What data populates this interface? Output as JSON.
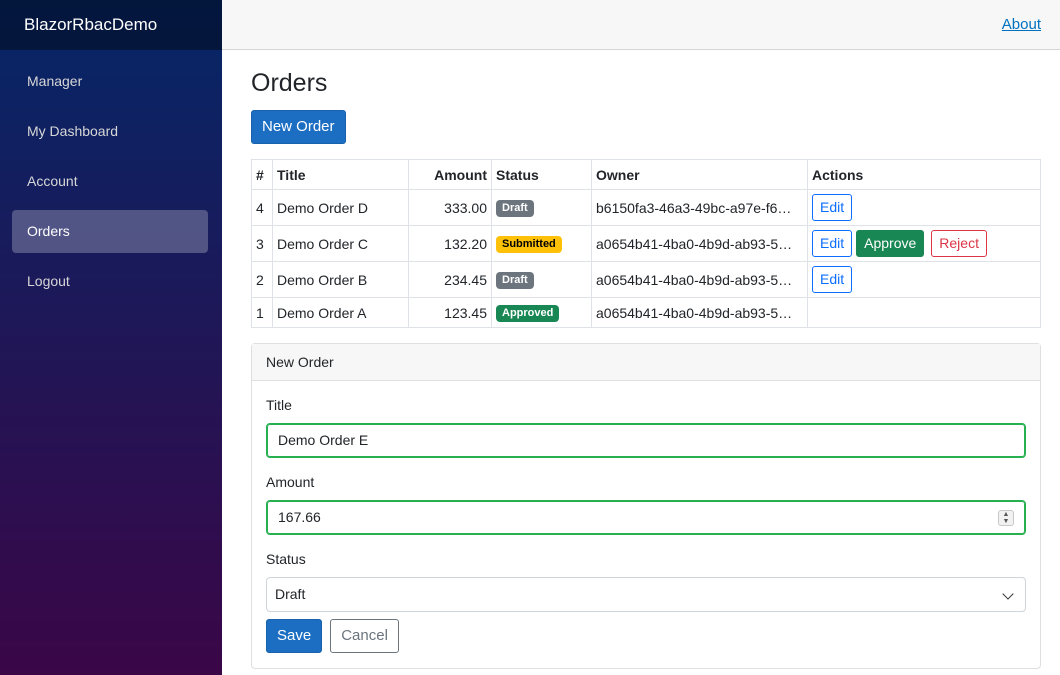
{
  "app": {
    "brand": "BlazorRbacDemo"
  },
  "sidebar": {
    "items": [
      {
        "label": "Manager"
      },
      {
        "label": "My Dashboard"
      },
      {
        "label": "Account"
      },
      {
        "label": "Orders",
        "active": true
      },
      {
        "label": "Logout"
      }
    ]
  },
  "topbar": {
    "about_link": "About"
  },
  "page": {
    "title": "Orders",
    "new_order_button": "New Order"
  },
  "table": {
    "headers": [
      "#",
      "Title",
      "Amount",
      "Status",
      "Owner",
      "Actions"
    ],
    "rows": [
      {
        "id": "4",
        "title": "Demo Order D",
        "amount": "333.00",
        "status": "Draft",
        "owner": "b6150fa3-46a3-49bc-a97e-f6…",
        "actions": [
          "Edit"
        ]
      },
      {
        "id": "3",
        "title": "Demo Order C",
        "amount": "132.20",
        "status": "Submitted",
        "owner": "a0654b41-4ba0-4b9d-ab93-5…",
        "actions": [
          "Edit",
          "Approve",
          "Reject"
        ]
      },
      {
        "id": "2",
        "title": "Demo Order B",
        "amount": "234.45",
        "status": "Draft",
        "owner": "a0654b41-4ba0-4b9d-ab93-5…",
        "actions": [
          "Edit"
        ]
      },
      {
        "id": "1",
        "title": "Demo Order A",
        "amount": "123.45",
        "status": "Approved",
        "owner": "a0654b41-4ba0-4b9d-ab93-5…",
        "actions": []
      }
    ]
  },
  "form": {
    "header": "New Order",
    "title_label": "Title",
    "title_value": "Demo Order E",
    "amount_label": "Amount",
    "amount_value": "167.66",
    "status_label": "Status",
    "status_value": "Draft",
    "save_button": "Save",
    "cancel_button": "Cancel"
  },
  "colors": {
    "primary": "#1b6ec2",
    "success": "#198754",
    "danger": "#dc3545",
    "warning": "#ffc107",
    "secondary": "#6c757d"
  },
  "icons": {
    "amount_spinner": "spinner-arrows-icon",
    "status_dropdown": "chevron-down-icon"
  }
}
